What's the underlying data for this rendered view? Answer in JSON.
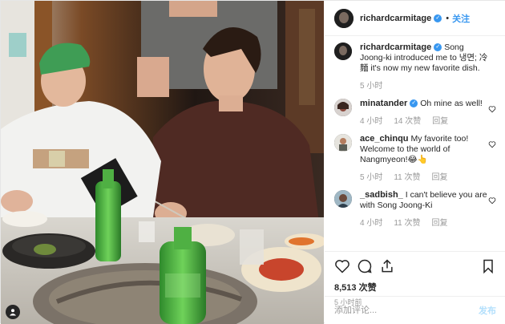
{
  "post": {
    "author": "richardcarmitage",
    "follow_label": "关注",
    "more_label": "•",
    "comments": [
      {
        "user": "richardcarmitage",
        "verified": true,
        "text": "Song Joong-ki introduced me to 냉면; 冷麵 it's now my new favorite dish.",
        "time": "5 小时",
        "likes": "",
        "reply": ""
      },
      {
        "user": "minatander",
        "verified": true,
        "text": "Oh mine as well!",
        "time": "4 小时",
        "likes": "14 次赞",
        "reply": "回复"
      },
      {
        "user": "ace_chinqu",
        "verified": false,
        "text": "My favorite too! Welcome to the world of Nangmyeon!😂👆",
        "time": "5 小时",
        "likes": "11 次赞",
        "reply": "回复"
      },
      {
        "user": "_sadbish_",
        "verified": false,
        "text": "I can't believe you are with Song Joong-Ki",
        "time": "4 小时",
        "likes": "11 次赞",
        "reply": "回复"
      }
    ],
    "likes_count": "8,513 次赞",
    "posted_time": "5 小时前",
    "add_comment_placeholder": "添加评论...",
    "post_button": "发布"
  },
  "colors": {
    "accent": "#3897f0",
    "muted": "#999999",
    "post_disabled": "#b2dffc"
  },
  "icons": [
    "heart-icon",
    "comment-icon",
    "share-icon",
    "bookmark-icon",
    "verified-badge-icon",
    "user-tag-icon"
  ]
}
